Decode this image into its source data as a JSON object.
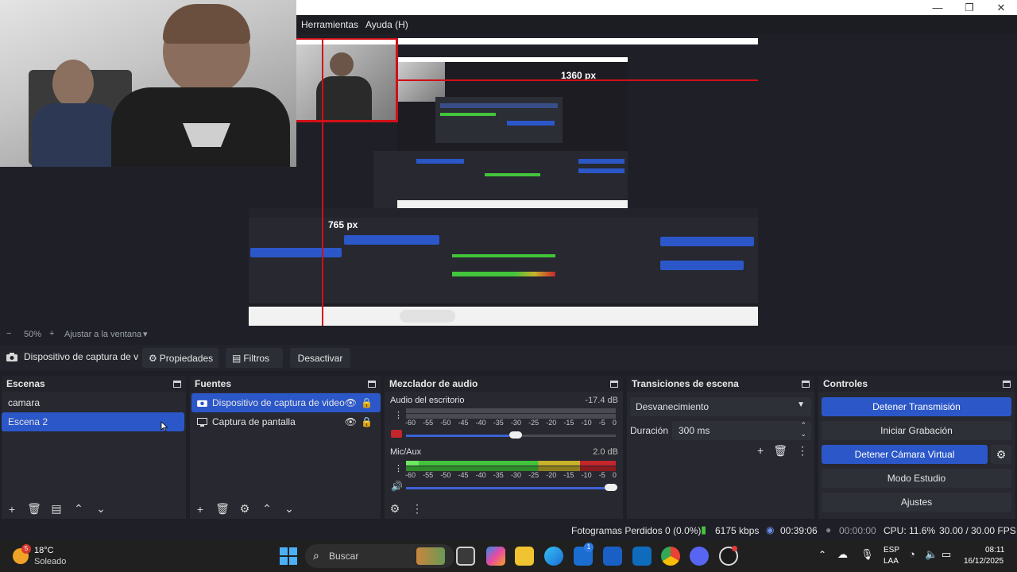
{
  "menu": {
    "herramientas": "Herramientas",
    "ayuda": "Ayuda (H)"
  },
  "window_controls": {
    "minimize": "—",
    "restore": "❐",
    "close": "✕"
  },
  "preview": {
    "label_width": "1360 px",
    "label_height": "765 px"
  },
  "zoom": {
    "minus": "−",
    "level": "50%",
    "plus": "+",
    "fit": "Ajustar a la ventana",
    "chevron": "▾"
  },
  "source_bar": {
    "source_name": "Dispositivo de captura de v",
    "properties": "Propiedades",
    "filters": "Filtros",
    "deactivate": "Desactivar"
  },
  "scenes": {
    "title": "Escenas",
    "items": [
      "camara",
      "Escena 2"
    ],
    "selected": 1
  },
  "sources": {
    "title": "Fuentes",
    "items": [
      {
        "label": "Dispositivo de captura de video",
        "icon": "camera-icon"
      },
      {
        "label": "Captura de pantalla",
        "icon": "monitor-icon"
      }
    ]
  },
  "mixer": {
    "title": "Mezclador de audio",
    "channels": [
      {
        "name": "Audio del escritorio",
        "level": "-17.4 dB",
        "muted": true,
        "volume": 0.76
      },
      {
        "name": "Mic/Aux",
        "level": "2.0 dB",
        "muted": false,
        "volume": 1.0
      }
    ],
    "scale": [
      "-60",
      "-55",
      "-50",
      "-45",
      "-40",
      "-35",
      "-30",
      "-25",
      "-20",
      "-15",
      "-10",
      "-5",
      "0"
    ]
  },
  "transitions": {
    "title": "Transiciones de escena",
    "selected": "Desvanecimiento",
    "duration_label": "Duración",
    "duration_value": "300 ms"
  },
  "controls": {
    "title": "Controles",
    "stop_stream": "Detener Transmisión",
    "start_record": "Iniciar Grabación",
    "stop_virtualcam": "Detener Cámara Virtual",
    "studio_mode": "Modo Estudio",
    "settings": "Ajustes"
  },
  "status": {
    "dropped": "Fotogramas Perdidos 0 (0.0%)",
    "bitrate": "6175 kbps",
    "stream_time": "00:39:06",
    "record_time": "00:00:00",
    "cpu": "CPU: 11.6%",
    "fps": "30.00 / 30.00 FPS"
  },
  "taskbar": {
    "weather_temp": "18°C",
    "weather_desc": "Soleado",
    "weather_badge": "5",
    "search": "Buscar",
    "lang1": "ESP",
    "lang2": "LAA",
    "time": "08:11",
    "date": "16/12/2025",
    "store_badge": "1"
  },
  "colors": {
    "accent": "#2b57c8",
    "meter_green": "#43c43b",
    "meter_yellow": "#c9b22b",
    "meter_red": "#c4262b",
    "guide_red": "#d20f17"
  }
}
